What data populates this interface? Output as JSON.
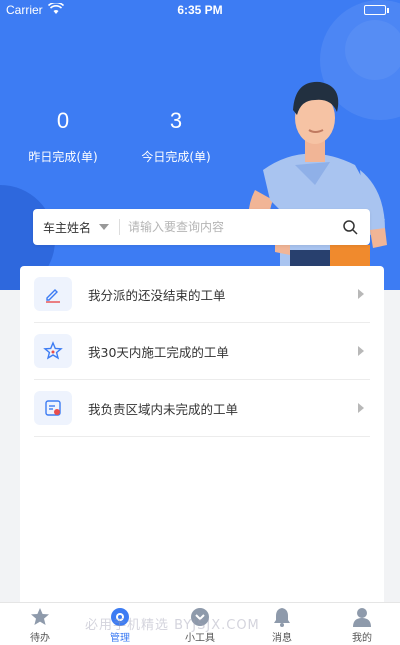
{
  "status_bar": {
    "carrier": "Carrier",
    "time": "6:35 PM",
    "battery_color": "#5ad25a"
  },
  "stats": [
    {
      "value": "0",
      "label": "昨日完成(单)"
    },
    {
      "value": "3",
      "label": "今日完成(单)"
    }
  ],
  "search": {
    "filter_label": "车主姓名",
    "placeholder": "请输入要查询内容",
    "value": ""
  },
  "menu": [
    {
      "label": "我分派的还没结束的工单",
      "icon": "pen-icon"
    },
    {
      "label": "我30天内施工完成的工单",
      "icon": "star-icon"
    },
    {
      "label": "我负责区域内未完成的工单",
      "icon": "clipboard-icon"
    }
  ],
  "tabs": [
    {
      "label": "待办",
      "icon": "star-icon"
    },
    {
      "label": "管理",
      "icon": "settings-icon",
      "active": true
    },
    {
      "label": "小工具",
      "icon": "chevron-badge-icon"
    },
    {
      "label": "消息",
      "icon": "bell-icon"
    },
    {
      "label": "我的",
      "icon": "user-icon"
    }
  ],
  "watermark": "必用手机精选 BYJSJX.COM",
  "colors": {
    "primary": "#3d7cf3",
    "background": "#f2f3f5"
  }
}
